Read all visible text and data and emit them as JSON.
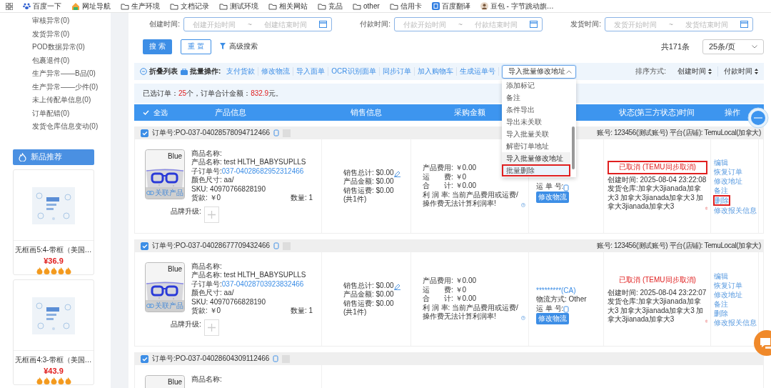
{
  "bookmarks": [
    {
      "label": "百度一下",
      "kind": "paw"
    },
    {
      "label": "网址导航",
      "kind": "nav"
    },
    {
      "label": "生产环境",
      "kind": "folder"
    },
    {
      "label": "文档记录",
      "kind": "folder"
    },
    {
      "label": "测试环境",
      "kind": "folder"
    },
    {
      "label": "相关网站",
      "kind": "folder"
    },
    {
      "label": "竞品",
      "kind": "folder"
    },
    {
      "label": "other",
      "kind": "folder"
    },
    {
      "label": "信用卡",
      "kind": "folder"
    },
    {
      "label": "百度翻译",
      "kind": "translate"
    },
    {
      "label": "豆包 - 字节跳动旗…",
      "kind": "avatar"
    }
  ],
  "sidebar": {
    "items": [
      "审核异常(0)",
      "发货异常(0)",
      "POD数据异常(0)",
      "包裹退件(0)",
      "生产异常——B品(0)",
      "生产异常——少件(0)",
      "未上传配单信息(0)",
      "订单配错(0)",
      "发货仓库信息变动(0)"
    ],
    "promo_button": "新品推荐",
    "products": [
      {
        "kind": "picture",
        "title": "无框画5:4-带框（美国…",
        "price": "¥36.9",
        "stars": 5
      },
      {
        "kind": "picture",
        "title": "无框画4:3-带框（美国…",
        "price": "¥43.9",
        "stars": 5
      }
    ]
  },
  "filters": [
    {
      "label": "创建时间:",
      "start_placeholder": "创建开始时间",
      "separator": "~",
      "end_placeholder": "创建结束时间"
    },
    {
      "label": "付款时间:",
      "start_placeholder": "付款开始时间",
      "separator": "~",
      "end_placeholder": "付款结束时间"
    },
    {
      "label": "发货时间:",
      "start_placeholder": "发货开始时间",
      "separator": "~",
      "end_placeholder": "发货结束时间"
    }
  ],
  "search_button": "搜 索",
  "reset_button": "重 置",
  "advanced_search": "高级搜索",
  "total": "共171条",
  "page_size": "25条/页",
  "toolbar": {
    "collapse": "折叠列表",
    "batch_label": "批量操作:",
    "actions": [
      "支付货款",
      "修改物流",
      "导入面单",
      "OCR识别面单",
      "同步订单",
      "加入购物车",
      "生成运单号"
    ],
    "dropdown": {
      "value": "导入批量修改地址",
      "expanded": true,
      "options": [
        {
          "label": "添加标记",
          "selected": false,
          "hovered": false,
          "highlighted": false
        },
        {
          "label": "备注",
          "selected": false,
          "hovered": false,
          "highlighted": false
        },
        {
          "label": "条件导出",
          "selected": false,
          "hovered": false,
          "highlighted": false
        },
        {
          "label": "导出未关联",
          "selected": false,
          "hovered": false,
          "highlighted": false
        },
        {
          "label": "导入批量关联",
          "selected": false,
          "hovered": false,
          "highlighted": false
        },
        {
          "label": "解密订单地址",
          "selected": false,
          "hovered": false,
          "highlighted": false
        },
        {
          "label": "导入批量修改地址",
          "selected": true,
          "hovered": false,
          "highlighted": false
        },
        {
          "label": "批量删除",
          "selected": false,
          "hovered": true,
          "highlighted": true
        }
      ]
    },
    "sort_label": "排序方式:",
    "sort_options": [
      "创建时间",
      "付款时间"
    ]
  },
  "summary": {
    "prefix": "已选订单：",
    "count": "25",
    "middle": "个，订单合计金额：",
    "amount": "832.9",
    "suffix": "元。"
  },
  "select_all": {
    "label": "全选",
    "checked": true
  },
  "columns": [
    "产品信息",
    "销售信息",
    "采购金额",
    "状态(第三方状态)时间",
    "操作"
  ],
  "orders": [
    {
      "order_no": "订单号:PO-037-04028578094712466",
      "checked": true,
      "account": "账号: 123456(测试账号) 平台(店铺): TemuLocal(加拿大)",
      "product": {
        "image_label": "Blue",
        "link_label": "关联产品",
        "name": "商品名称:",
        "title": "产品名称: test HLTH_BABYSUPLLS",
        "sub_order_label": "子订单号:",
        "sub_order": "037-04028682952312466",
        "color_size": "颜色尺寸: aa/",
        "sku": "SKU: 40970766828190",
        "payment": "货款: ￥0",
        "quantity": "数量: 1",
        "brand_label": "品牌升级:"
      },
      "sales": [
        "销售总计: $0.00",
        "产品金额: $0.00",
        "销售运费: $0.00",
        "(共1件)"
      ],
      "purchase": [
        "产品费用: ￥0.00",
        "运　　费: ￥0",
        "合　　计: ￥0.00",
        "利 润 率: 当前产品费用或运费/操作费无法计算利润率!"
      ],
      "logistics": {
        "waybill": "运 单 号:",
        "button": "修改物流"
      },
      "status": {
        "label": "已取消 (TEMU同步取消)",
        "highlighted": true,
        "created": "创建时间: 2025-08-04 23:22:08",
        "warehouse": "发货仓库:加拿大3jianada加拿大3 加拿大3jianada加拿大3 加拿大3jianada加拿大3"
      },
      "actions": [
        {
          "label": "编辑",
          "highlighted": false
        },
        {
          "label": "恢复订单",
          "highlighted": false
        },
        {
          "label": "修改地址",
          "highlighted": false
        },
        {
          "label": "备注",
          "highlighted": false
        },
        {
          "label": "删除",
          "highlighted": true
        },
        {
          "label": "修改报关信息",
          "highlighted": false
        }
      ]
    },
    {
      "order_no": "订单号:PO-037-04028677709432466",
      "checked": true,
      "account": "账号: 123456(测试账号) 平台(店铺): TemuLocal(加拿大)",
      "product": {
        "image_label": "Blue",
        "link_label": "关联产品",
        "name": "商品名称:",
        "title": "产品名称: test HLTH_BABYSUPLLS",
        "sub_order_label": "子订单号:",
        "sub_order": "037-04028703923832466",
        "color_size": "颜色尺寸: aa/",
        "sku": "SKU: 40970766828190",
        "payment": "货款: ￥0",
        "quantity": "数量: 1",
        "brand_label": "品牌升级:"
      },
      "sales": [
        "销售总计: $0.00",
        "产品金额: $0.00",
        "销售运费: $0.00",
        "(共1件)"
      ],
      "purchase": [
        "产品费用: ￥0.00",
        "运　　费: ￥0",
        "合　　计: ￥0.00",
        "利 润 率: 当前产品费用或运费/操作费无法计算利润率!"
      ],
      "logistics": {
        "carrier": "*********(CA)",
        "method": "物流方式: Other",
        "waybill": "运 单 号:",
        "button": "修改物流"
      },
      "status": {
        "label": "已取消 (TEMU同步取消)",
        "highlighted": false,
        "created": "创建时间: 2025-08-04 23:22:07",
        "warehouse": "发货仓库:加拿大3jianada加拿大3 加拿大3jianada加拿大3 加拿大3jianada加拿大3"
      },
      "actions": [
        {
          "label": "编辑",
          "highlighted": false
        },
        {
          "label": "恢复订单",
          "highlighted": false
        },
        {
          "label": "修改地址",
          "highlighted": false
        },
        {
          "label": "备注",
          "highlighted": false
        },
        {
          "label": "删除",
          "highlighted": false
        },
        {
          "label": "修改报关信息",
          "highlighted": false
        }
      ]
    },
    {
      "order_no": "订单号:PO-037-04028604309112466",
      "checked": true,
      "product": {
        "image_label": "Blue",
        "name": "商品名称:"
      }
    }
  ]
}
